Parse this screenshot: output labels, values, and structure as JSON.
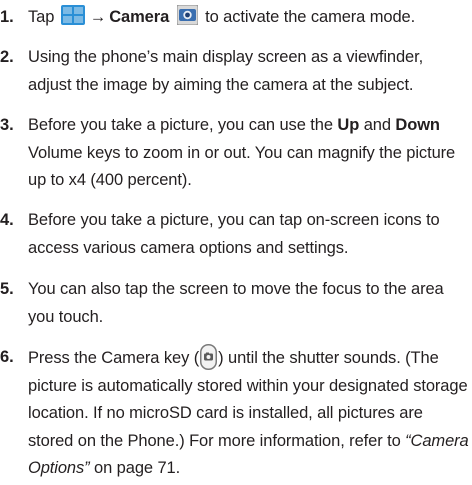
{
  "steps": [
    {
      "num": "1.",
      "tap": "Tap",
      "arrow": "→",
      "camera_label": "Camera",
      "rest": "to activate the camera mode.",
      "icons": [
        "apps-grid-icon",
        "camera-app-icon"
      ]
    },
    {
      "num": "2.",
      "text": "Using the phone’s main display screen as a viewfinder, adjust the image by aiming the camera at the subject."
    },
    {
      "num": "3.",
      "pre": "Before you take a picture, you can use the",
      "up": "Up",
      "and": "and",
      "down": "Down",
      "post": "Volume keys to zoom in or out. You can magnify the picture up to x4 (400 percent)."
    },
    {
      "num": "4.",
      "text": "Before you take a picture, you can tap on-screen icons to access various camera options and settings."
    },
    {
      "num": "5.",
      "text": "You can also tap the screen to move the focus to the area you touch."
    },
    {
      "num": "6.",
      "pre": "Press the Camera key (",
      "post": ") until the shutter sounds. (The picture is automatically stored within your designated storage location. If no microSD card is installed, all pictures are stored on the Phone.) For more information, refer to",
      "ref": "“Camera Options”",
      "ref_tail": "on page 71.",
      "icon": "camera-key-icon"
    }
  ],
  "colors": {
    "text": "#231f20",
    "apps_icon_blue": "#2a8fd6",
    "camera_icon_bg": "#3b6fb0"
  }
}
